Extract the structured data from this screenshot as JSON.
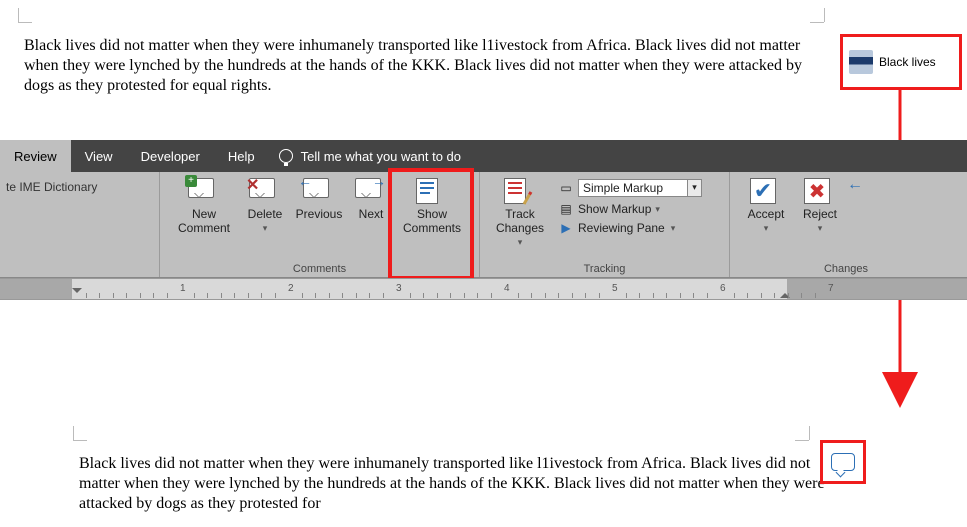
{
  "document": {
    "paragraph": "Black lives did not matter when they were inhumanely transported like l1ivestock from Africa. Black lives did not matter when they were lynched by the hundreds at the hands of the KKK. Black lives did not matter when they were attacked by dogs as they protested for equal rights.",
    "paragraph_truncated": "Black lives did not matter when they were inhumanely transported like l1ivestock from Africa. Black lives did not matter when they were lynched by the hundreds at the hands of the KKK. Black lives did not matter when they were attacked by dogs as they protested for"
  },
  "comment": {
    "preview_text": "Black lives"
  },
  "tabs": {
    "review": "Review",
    "view": "View",
    "developer": "Developer",
    "help": "Help",
    "tellme": "Tell me what you want to do"
  },
  "ime": {
    "label": "te IME Dictionary"
  },
  "comments": {
    "new": "New Comment",
    "delete": "Delete",
    "previous": "Previous",
    "next": "Next",
    "show": "Show Comments",
    "group": "Comments"
  },
  "tracking": {
    "track": "Track Changes",
    "display_selected": "Simple Markup",
    "show_markup": "Show Markup",
    "reviewing_pane": "Reviewing Pane",
    "group": "Tracking"
  },
  "changes": {
    "accept": "Accept",
    "reject": "Reject",
    "group": "Changes"
  },
  "ruler": {
    "nums": [
      "1",
      "2",
      "3",
      "4",
      "5",
      "6",
      "7"
    ]
  }
}
